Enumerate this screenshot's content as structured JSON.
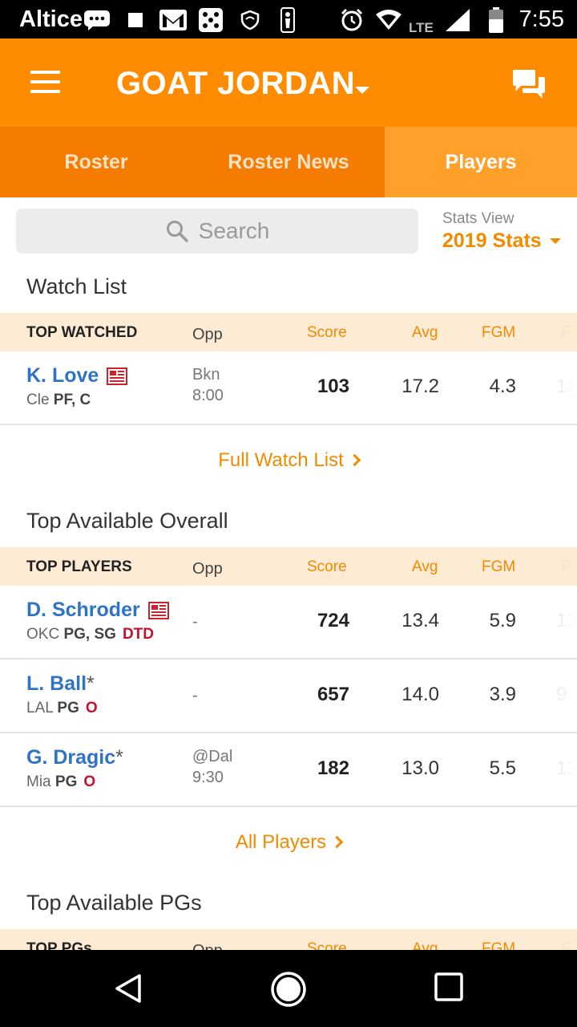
{
  "status_bar": {
    "carrier": "Altice",
    "network": "LTE",
    "time": "7:55"
  },
  "app_bar": {
    "title": "GOAT JORDAN"
  },
  "tabs": [
    {
      "label": "Roster"
    },
    {
      "label": "Roster News"
    },
    {
      "label": "Players"
    }
  ],
  "search": {
    "placeholder": "Search"
  },
  "stats_view": {
    "label": "Stats View",
    "value": "2019 Stats"
  },
  "watch_list": {
    "title": "Watch List",
    "header": {
      "first": "TOP WATCHED",
      "opp": "Opp",
      "score": "Score",
      "avg": "Avg",
      "fgm": "FGM",
      "cut": "F"
    },
    "rows": [
      {
        "name": "K. Love",
        "team": "Cle",
        "pos": "PF, C",
        "status": "",
        "opp1": "Bkn",
        "opp2": "8:00",
        "score": "103",
        "avg": "17.2",
        "fgm": "4.3",
        "cut": "13"
      }
    ],
    "link": "Full Watch List"
  },
  "top_available": {
    "title": "Top Available Overall",
    "header": {
      "first": "TOP PLAYERS",
      "opp": "Opp",
      "score": "Score",
      "avg": "Avg",
      "fgm": "FGM",
      "cut": "F"
    },
    "rows": [
      {
        "name": "D. Schroder",
        "asterisk": "",
        "team": "OKC",
        "pos": "PG, SG",
        "status": "DTD",
        "opp1": "-",
        "opp2": "",
        "score": "724",
        "avg": "13.4",
        "fgm": "5.9",
        "cut": "13"
      },
      {
        "name": "L. Ball",
        "asterisk": "*",
        "team": "LAL",
        "pos": "PG",
        "status": "O",
        "opp1": "-",
        "opp2": "",
        "score": "657",
        "avg": "14.0",
        "fgm": "3.9",
        "cut": "9"
      },
      {
        "name": "G. Dragic",
        "asterisk": "*",
        "team": "Mia",
        "pos": "PG",
        "status": "O",
        "opp1": "@Dal",
        "opp2": "9:30",
        "score": "182",
        "avg": "13.0",
        "fgm": "5.5",
        "cut": "13"
      }
    ],
    "link": "All Players"
  },
  "top_pgs": {
    "title": "Top Available PGs",
    "header": {
      "first": "TOP PGs",
      "opp": "Opp",
      "score": "Score",
      "avg": "Avg",
      "fgm": "FGM",
      "cut": "F"
    }
  },
  "colors": {
    "primary": "#ff8c00",
    "tab_bar": "#f57c00",
    "tab_active": "#ffa02a",
    "accent": "#f28a00",
    "link": "#2e73c4",
    "status_red": "#c8102e"
  }
}
